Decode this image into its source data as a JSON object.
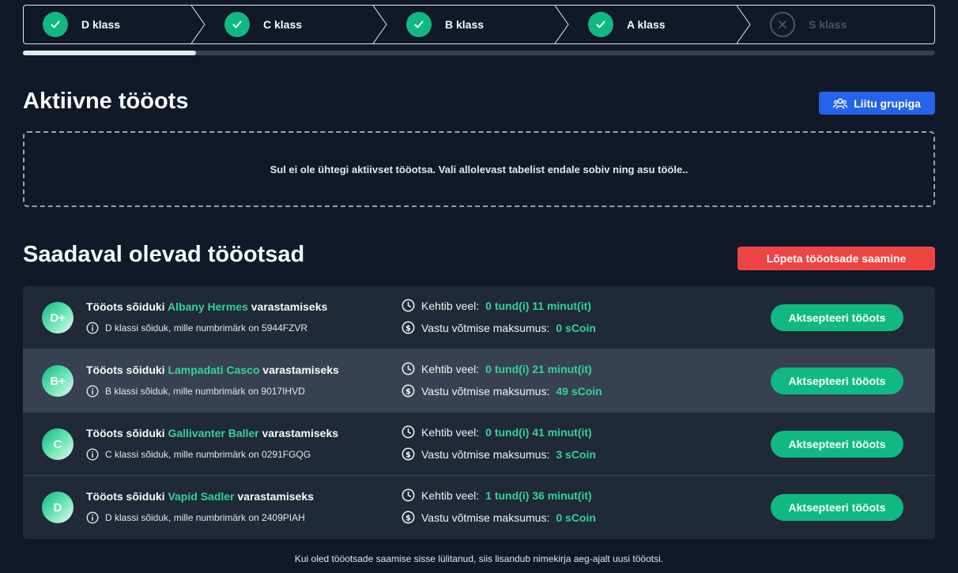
{
  "stepper": {
    "steps": [
      {
        "label": "D klass",
        "status": "done"
      },
      {
        "label": "C klass",
        "status": "done"
      },
      {
        "label": "B klass",
        "status": "done"
      },
      {
        "label": "A klass",
        "status": "done"
      },
      {
        "label": "S klass",
        "status": "locked"
      }
    ],
    "progress_fraction": 0.19
  },
  "active_job": {
    "heading": "Aktiivne tööots",
    "join_group_label": "Liitu grupiga",
    "empty_message": "Sul ei ole ühtegi aktiivset tööotsa. Vali allolevast tabelist endale sobiv ning asu tööle.."
  },
  "available_jobs": {
    "heading": "Saadaval olevad tööotsad",
    "stop_button_label": "Lõpeta tööotsade saamine",
    "jobs": [
      {
        "grade": "D+",
        "title_prefix": "Tööots sõiduki",
        "car": "Albany Hermes",
        "title_suffix": "varastamiseks",
        "description": "D klassi sõiduk, mille numbrimärk on 5944FZVR",
        "valid_label": "Kehtib veel:",
        "valid_value": "0 tund(i) 11 minut(it)",
        "pay_label": "Vastu võtmise maksumus:",
        "pay_value": "0 sCoin",
        "accept_label": "Aktsepteeri tööots"
      },
      {
        "grade": "B+",
        "title_prefix": "Tööots sõiduki",
        "car": "Lampadati Casco",
        "title_suffix": "varastamiseks",
        "description": "B klassi sõiduk, mille numbrimärk on 9017IHVD",
        "valid_label": "Kehtib veel:",
        "valid_value": "0 tund(i) 21 minut(it)",
        "pay_label": "Vastu võtmise maksumus:",
        "pay_value": "49 sCoin",
        "accept_label": "Aktsepteeri tööots"
      },
      {
        "grade": "C",
        "title_prefix": "Tööots sõiduki",
        "car": "Gallivanter Baller",
        "title_suffix": "varastamiseks",
        "description": "C klassi sõiduk, mille numbrimärk on 0291FGQG",
        "valid_label": "Kehtib veel:",
        "valid_value": "0 tund(i) 41 minut(it)",
        "pay_label": "Vastu võtmise maksumus:",
        "pay_value": "3 sCoin",
        "accept_label": "Aktsepteeri tööots"
      },
      {
        "grade": "D",
        "title_prefix": "Tööots sõiduki",
        "car": "Vapid Sadler",
        "title_suffix": "varastamiseks",
        "description": "D klassi sõiduk, mille numbrimärk on 2409PIAH",
        "valid_label": "Kehtib veel:",
        "valid_value": "1 tund(i) 36 minut(it)",
        "pay_label": "Vastu võtmise maksumus:",
        "pay_value": "0 sCoin",
        "accept_label": "Aktsepteeri tööots"
      }
    ],
    "footer_note": "Kui oled tööotsade saamise sisse lülitanud, siis lisandub nimekirja aeg-ajalt uusi tööotsi."
  },
  "colors": {
    "background": "#111827",
    "accent_green": "#10b981",
    "accent_blue": "#2563eb",
    "accent_red": "#ef4444"
  }
}
